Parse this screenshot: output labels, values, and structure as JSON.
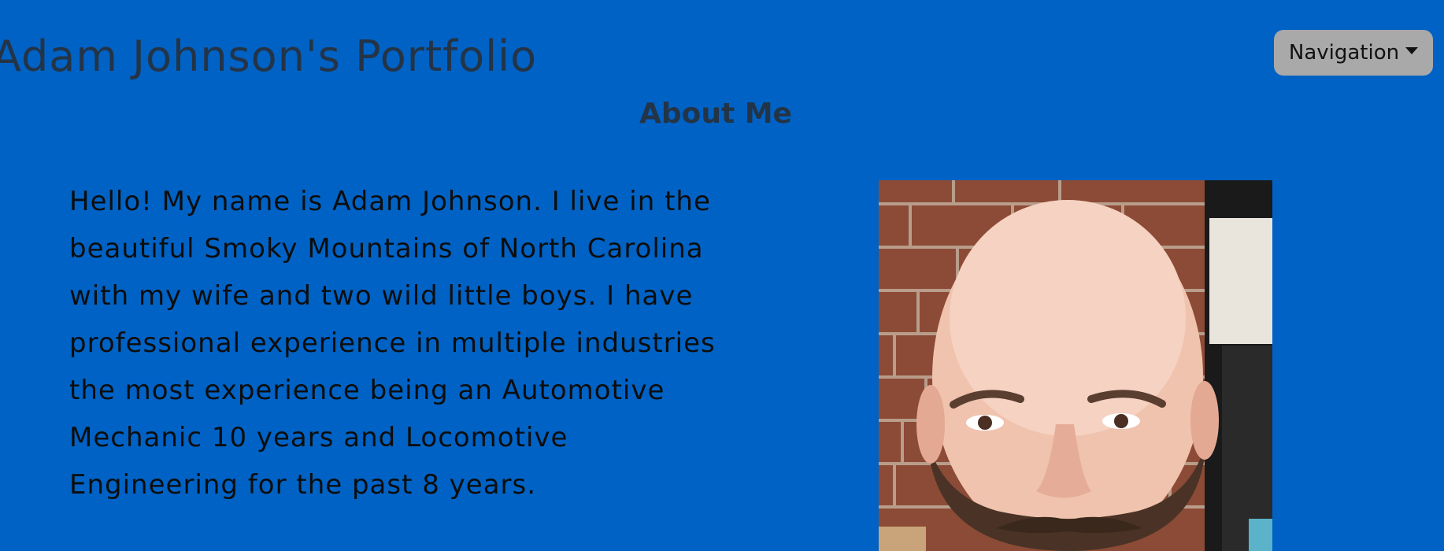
{
  "header": {
    "title": "Adam Johnson's Portfolio",
    "nav_label": "Navigation"
  },
  "about": {
    "heading": "About Me",
    "text": "Hello! My name is Adam Johnson. I live in the beautiful Smoky Mountains of North Carolina with my wife and two wild little boys. I have professional experience in multiple industries the most experience being an Automotive Mechanic 10 years and Locomotive Engineering for the past 8 years."
  },
  "colors": {
    "background": "#0062c4",
    "title_text": "#243447",
    "nav_button": "#a9a9a9"
  }
}
